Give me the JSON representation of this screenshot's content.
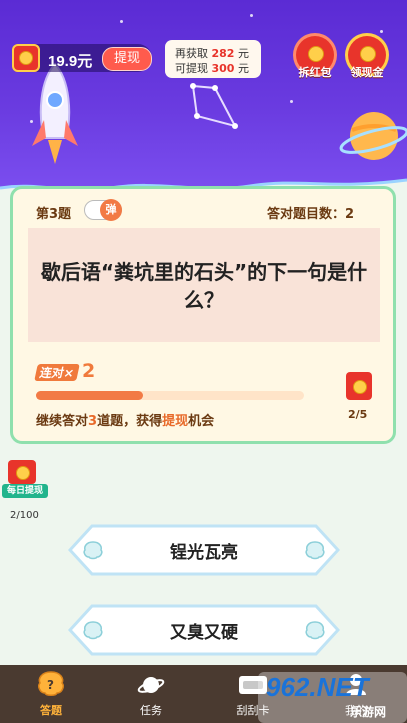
{
  "header": {
    "balance": "19.9元",
    "withdraw_label": "提现",
    "info": {
      "line1_prefix": "再获取",
      "line1_value": "282",
      "line1_suffix": "元",
      "line2_prefix": "可提现",
      "line2_value": "300",
      "line2_suffix": "元"
    },
    "red_packet_label": "拆红包",
    "cash_label": "领现金"
  },
  "quiz": {
    "question_number": "第3题",
    "toggle_label": "弹",
    "correct_count": "答对题目数：2",
    "question": "歇后语“粪坑里的石头”的下一句是什么？",
    "streak_label": "连对×",
    "streak_value": "2",
    "progress": 0.4,
    "hint_prefix": "继续答对",
    "hint_num": "3",
    "hint_mid": "道题，获得",
    "hint_highlight": "提现",
    "hint_suffix": "机会",
    "reward_count": "2/5"
  },
  "daily": {
    "label": "每日提现",
    "count": "2/100"
  },
  "options": [
    {
      "label": "锃光瓦亮"
    },
    {
      "label": "又臭又硬"
    }
  ],
  "nav": {
    "items": [
      {
        "label": "答题",
        "active": true
      },
      {
        "label": "任务",
        "active": false
      },
      {
        "label": "刮刮卡",
        "active": false
      },
      {
        "label": "我的",
        "active": false
      }
    ]
  },
  "watermark": {
    "brand": "962.NET",
    "site": "乐游网"
  },
  "colors": {
    "header_purple": "#5b2bd4",
    "accent_orange": "#f27a45",
    "card_border_green": "#8fe0ad",
    "red_packet": "#e8342b",
    "nav_bg": "#4a3a30",
    "nav_active": "#ffb23a"
  }
}
